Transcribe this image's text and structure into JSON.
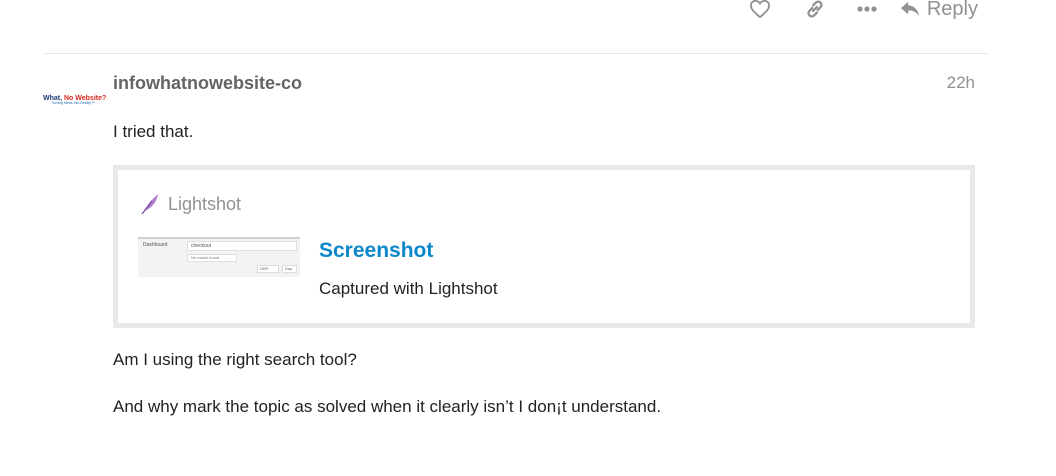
{
  "actions": {
    "like_icon": "heart-icon",
    "link_icon": "link-icon",
    "more_icon": "more-icon",
    "reply_label": "Reply"
  },
  "post": {
    "avatar": {
      "line1_a": "What, ",
      "line1_b": "No Website?",
      "line2": "Turning Ideas Into Reality™"
    },
    "username": "infowhatnowebsite-co",
    "timestamp": "22h",
    "paragraph_1": "I tried that.",
    "onebox": {
      "source": "Lightshot",
      "title": "Screenshot",
      "description": "Captured with Lightshot",
      "thumbnail": {
        "dashboard": "Dashboard",
        "search_value": "checkout",
        "no_match": "No match found",
        "currency": "GBP",
        "period": "Day"
      }
    },
    "paragraph_2": "Am I using the right search tool?",
    "paragraph_3": "And why mark the topic as solved when it clearly isn’t I don¡t understand."
  },
  "colors": {
    "link": "#0b88c9",
    "muted": "#919191",
    "border": "#e9e9e9"
  }
}
